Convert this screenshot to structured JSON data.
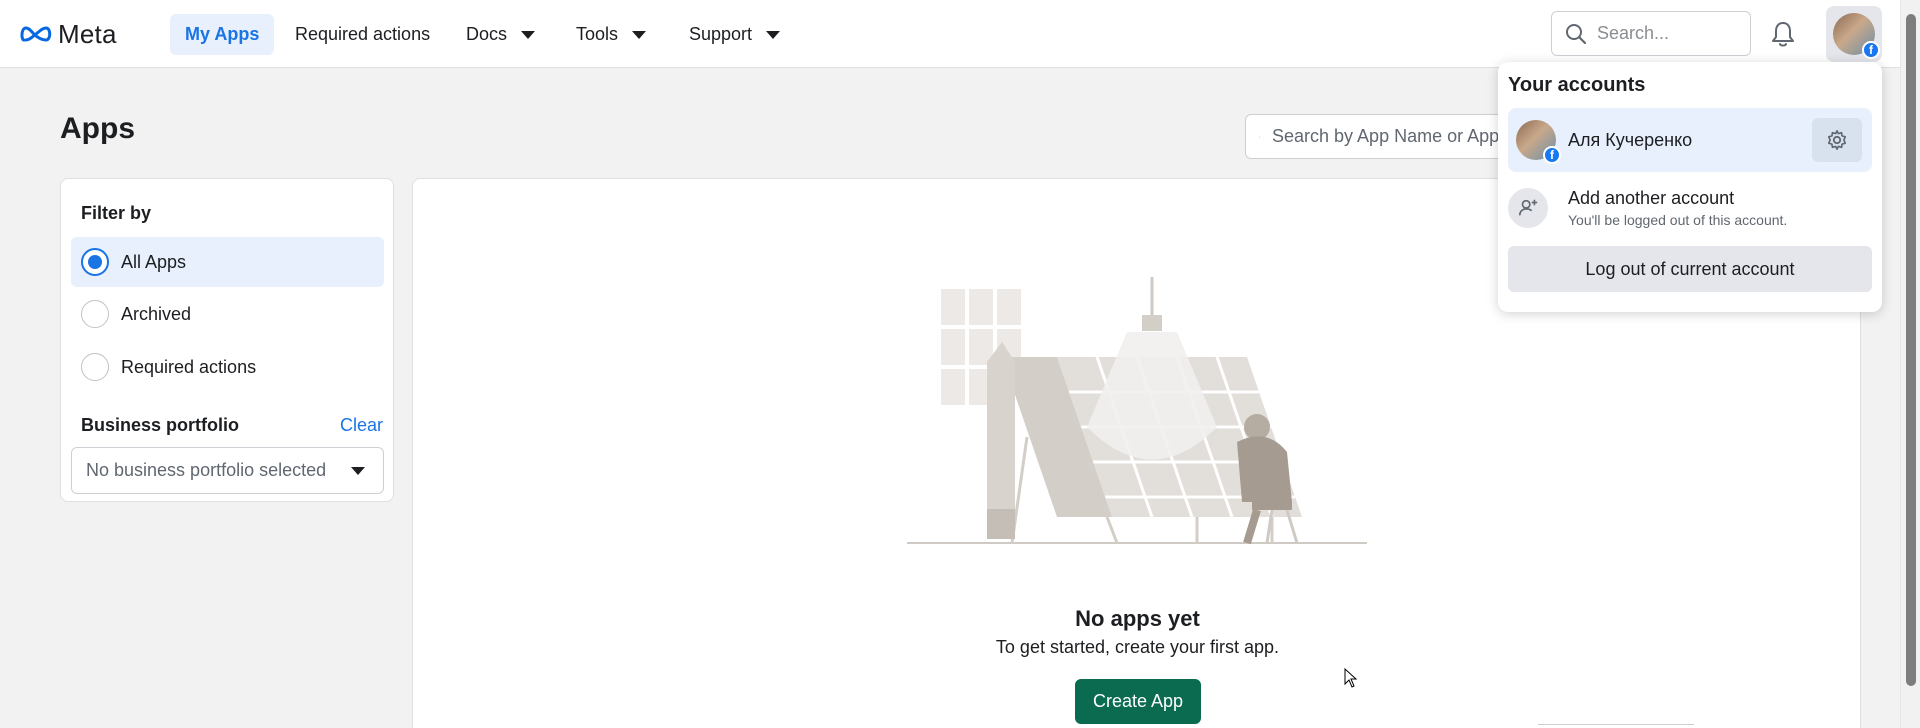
{
  "nav": {
    "logo_text": "Meta",
    "items": [
      {
        "label": "My Apps"
      },
      {
        "label": "Required actions"
      },
      {
        "label": "Docs"
      },
      {
        "label": "Tools"
      },
      {
        "label": "Support"
      }
    ],
    "search_placeholder": "Search..."
  },
  "page": {
    "title": "Apps",
    "search_placeholder": "Search by App Name or App ID"
  },
  "filter": {
    "title": "Filter by",
    "options": [
      {
        "label": "All Apps",
        "selected": true
      },
      {
        "label": "Archived",
        "selected": false
      },
      {
        "label": "Required actions",
        "selected": false
      }
    ],
    "business_portfolio_title": "Business portfolio",
    "clear_label": "Clear",
    "business_portfolio_value": "No business portfolio selected"
  },
  "empty_state": {
    "title": "No apps yet",
    "subtitle": "To get started, create your first app.",
    "create_button": "Create App"
  },
  "accounts_menu": {
    "title": "Your accounts",
    "current_account_name": "Аля Кучеренко",
    "add_account_title": "Add another account",
    "add_account_subtitle": "You'll be logged out of this account.",
    "logout_label": "Log out of current account"
  },
  "colors": {
    "brand_blue": "#1b74e4",
    "active_bg": "#e7f0fc",
    "create_green": "#0a6b50",
    "facebook_blue": "#1877f2"
  }
}
